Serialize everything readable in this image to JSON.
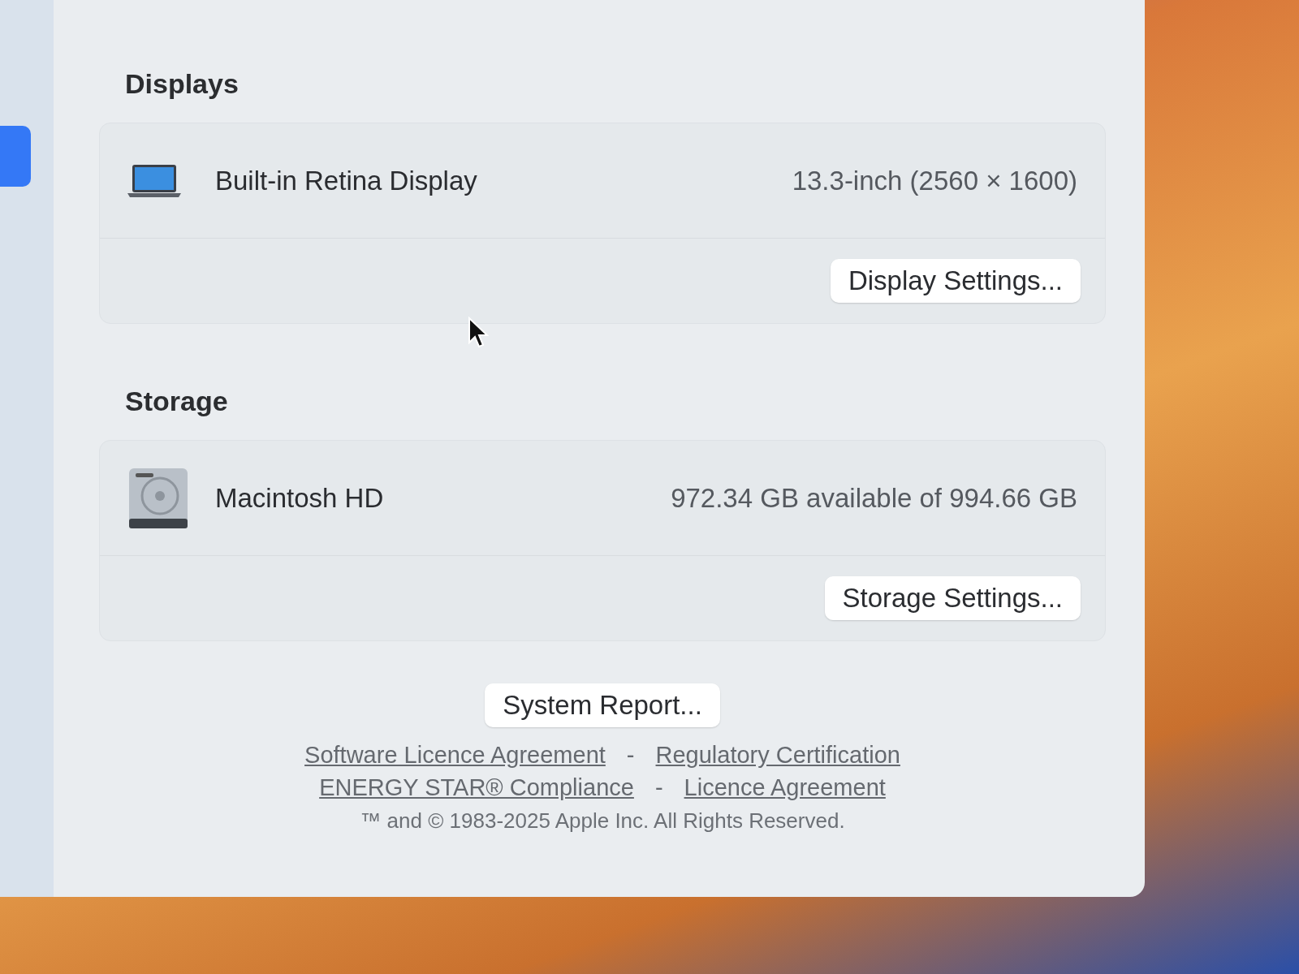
{
  "sidebar": {
    "items": [
      {
        "selected": true
      }
    ]
  },
  "sections": [
    {
      "title": "Displays",
      "item": {
        "kind": "display",
        "name": "Built-in Retina Display",
        "detail": "13.3-inch (2560 × 1600)"
      },
      "button": "Display Settings..."
    },
    {
      "title": "Storage",
      "item": {
        "kind": "disk",
        "name": "Macintosh HD",
        "detail": "972.34 GB available of 994.66 GB"
      },
      "button": "Storage Settings..."
    }
  ],
  "system_report_button": "System Report...",
  "links": [
    [
      "Software Licence Agreement",
      "Regulatory Certification"
    ],
    [
      "ENERGY STAR® Compliance",
      "Licence Agreement"
    ]
  ],
  "separator": "-",
  "copyright": "™ and © 1983-2025 Apple Inc. All Rights Reserved."
}
